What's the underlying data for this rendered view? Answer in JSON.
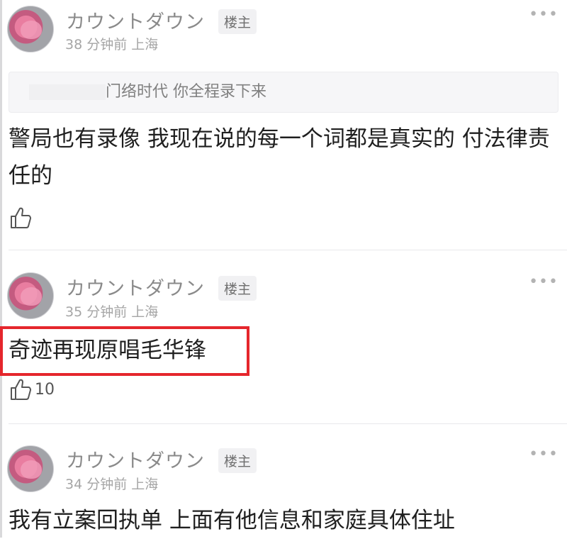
{
  "comments": [
    {
      "author": "カウントダウン",
      "badge": "楼主",
      "meta": "38 分钟前 上海",
      "more": "•••",
      "quote": "门络时代 你全程录下来",
      "text": "警局也有录像 我现在说的每一个词都是真实的 付法律责任的",
      "likes": ""
    },
    {
      "author": "カウントダウン",
      "badge": "楼主",
      "meta": "35 分钟前 上海",
      "more": "•••",
      "text": "奇迹再现原唱毛华锋",
      "likes": "10",
      "highlighted": true,
      "highlight_color": "#e5262c"
    },
    {
      "author": "カウントダウン",
      "badge": "楼主",
      "meta": "34 分钟前 上海",
      "more": "•••",
      "text": "我有立案回执单 上面有他信息和家庭具体住址"
    }
  ],
  "icons": {
    "like": "thumbs-up-icon",
    "more": "more-dots-icon",
    "avatar": "avatar"
  },
  "colors": {
    "highlight": "#e5262c",
    "name": "#8a8a8a",
    "meta": "#a5a5a5"
  }
}
